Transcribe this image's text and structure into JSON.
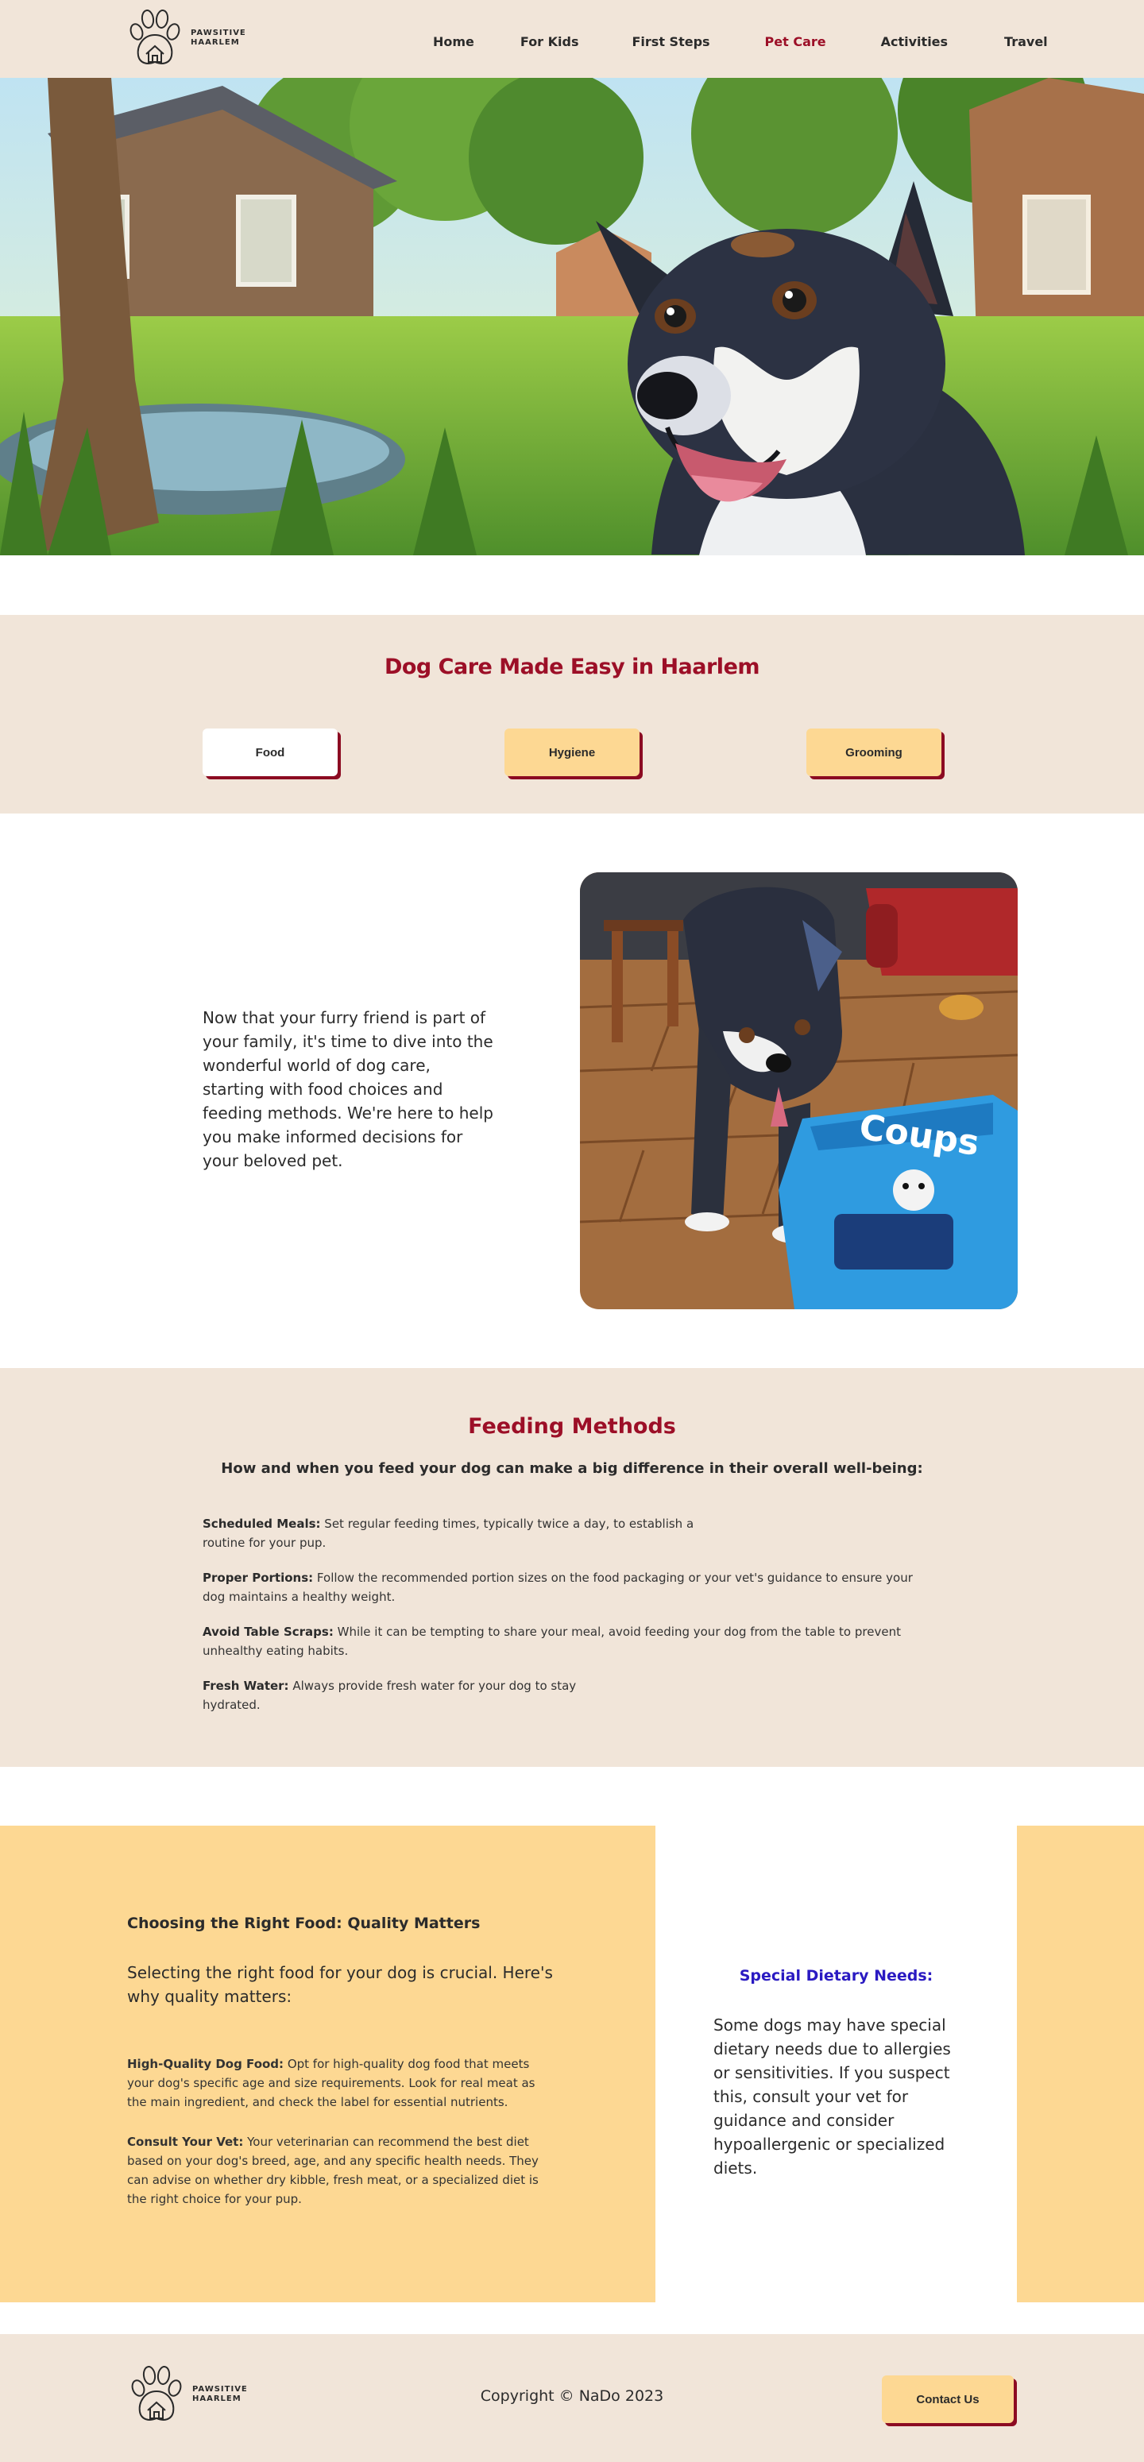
{
  "header": {
    "brand_line1": "PAWSITIVE",
    "brand_line2": "HAARLEM",
    "nav": [
      "Home",
      "For Kids",
      "First Steps",
      "Pet Care",
      "Activities",
      "Travel"
    ],
    "active_nav": "Pet Care"
  },
  "care": {
    "title": "Dog Care Made Easy in Haarlem",
    "tabs": [
      "Food",
      "Hygiene",
      "Grooming"
    ],
    "active_tab": "Food"
  },
  "intro": {
    "text": "Now that your furry friend is part of your family, it's time to dive into the wonderful world of dog care, starting with food choices and feeding methods. We're here to help you make informed decisions for your beloved pet.",
    "bag_label": "Coups"
  },
  "feeding": {
    "title": "Feeding Methods",
    "subtitle": "How and when you feed your dog can make a big difference in their overall well-being:",
    "items": [
      {
        "label": "Scheduled Meals:",
        "text": " Set regular feeding times, typically twice a day, to establish a routine for your pup."
      },
      {
        "label": "Proper Portions:",
        "text": " Follow the recommended portion sizes on the food packaging or your vet's guidance to ensure your dog maintains a healthy weight."
      },
      {
        "label": "Avoid Table Scraps:",
        "text": " While it can be tempting to share your meal, avoid feeding your dog from the table to prevent unhealthy eating habits."
      },
      {
        "label": "Fresh Water:",
        "text": " Always provide fresh water for your dog to stay hydrated."
      }
    ]
  },
  "food": {
    "title": "Choosing the Right Food: Quality Matters",
    "lead": "Selecting the right food for your dog is crucial. Here's why quality matters:",
    "items": [
      {
        "label": "High-Quality Dog Food:",
        "text": " Opt for high-quality dog food that meets your dog's specific age and size requirements. Look for real meat as the main ingredient, and check the label for essential nutrients."
      },
      {
        "label": "Consult Your Vet:",
        "text": " Your veterinarian can recommend the best diet based on your dog's breed, age, and any specific health needs. They can advise on whether dry kibble, fresh meat, or a specialized diet is the right choice for your pup."
      }
    ]
  },
  "special": {
    "title": "Special Dietary Needs:",
    "text": "Some dogs may have special dietary needs due to allergies or sensitivities. If you suspect this, consult your vet for guidance and consider hypoallergenic or specialized diets."
  },
  "footer": {
    "copyright": "Copyright © NaDo 2023",
    "contact": "Contact Us"
  },
  "colors": {
    "cream": "#f1e5d9",
    "yellow": "#fdd893",
    "crimson": "#9c0f27",
    "blue_heading": "#2a1ac2"
  }
}
